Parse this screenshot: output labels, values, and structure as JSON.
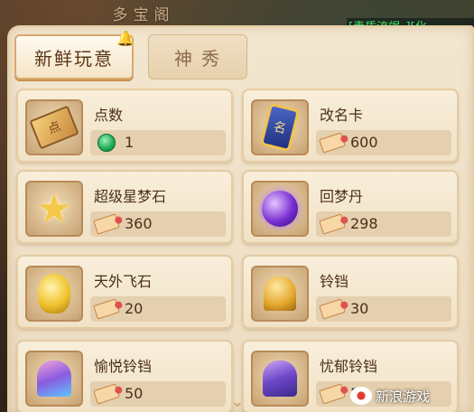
{
  "header": {
    "shop_title": "多宝阁",
    "chat_text": "[素质流氓。][化",
    "chat_highlight": "素质流氓。"
  },
  "tabs": [
    {
      "label": "新鲜玩意",
      "active": true
    },
    {
      "label": "神 秀",
      "active": false
    }
  ],
  "items": [
    {
      "name": "点数",
      "price": "1",
      "currency": "jade-coin",
      "art": "card"
    },
    {
      "name": "改名卡",
      "price": "600",
      "currency": "ticket",
      "art": "rename"
    },
    {
      "name": "超级星梦石",
      "price": "360",
      "currency": "ticket",
      "art": "star"
    },
    {
      "name": "回梦丹",
      "price": "298",
      "currency": "ticket",
      "art": "orb"
    },
    {
      "name": "天外飞石",
      "price": "20",
      "currency": "ticket",
      "art": "rock"
    },
    {
      "name": "铃铛",
      "price": "30",
      "currency": "ticket",
      "art": "bell"
    },
    {
      "name": "愉悦铃铛",
      "price": "50",
      "currency": "ticket",
      "art": "joy"
    },
    {
      "name": "忧郁铃铛",
      "price": "50",
      "currency": "ticket",
      "art": "gloom"
    }
  ],
  "art_text": {
    "card": "点",
    "rename": "名"
  },
  "watermark": {
    "text": "新浪游戏"
  },
  "colors": {
    "panel": "#f3e6cf",
    "card": "#f8eeda",
    "text": "#4a2f19",
    "chat_green": "#3fe46b"
  }
}
